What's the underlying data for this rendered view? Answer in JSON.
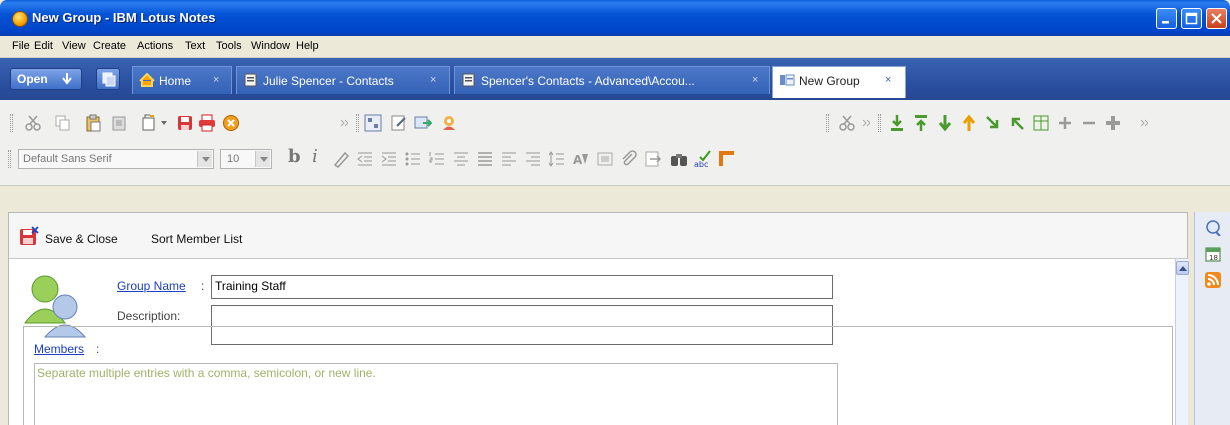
{
  "window": {
    "title": "New Group - IBM Lotus Notes"
  },
  "menu": [
    "File",
    "Edit",
    "View",
    "Create",
    "Actions",
    "Text",
    "Tools",
    "Window",
    "Help"
  ],
  "tabs": {
    "open_label": "Open",
    "items": [
      {
        "label": "Home",
        "icon": "home-icon",
        "active": false
      },
      {
        "label": "Julie Spencer - Contacts",
        "icon": "contacts-icon",
        "active": false
      },
      {
        "label": "Spencer's Contacts - Advanced\\Accou...",
        "icon": "contacts-icon",
        "active": false
      },
      {
        "label": "New Group",
        "icon": "group-icon",
        "active": true
      }
    ],
    "close_glyph": "×"
  },
  "format_toolbar": {
    "font": "Default Sans Serif",
    "size": "10"
  },
  "actions": {
    "save_close": "Save & Close",
    "sort_members": "Sort Member List"
  },
  "form": {
    "group_name_label": "Group Name",
    "group_name_value": "Training Staff",
    "description_label": "Description:",
    "description_value": "",
    "members_label": "Members",
    "members_placeholder": "Separate multiple entries with a comma, semicolon, or new line."
  },
  "colors": {
    "titlebar": "#0453d6",
    "tabbar": "#2a4f9f",
    "link": "#1b3ec2",
    "placeholder": "#a2b26a"
  }
}
